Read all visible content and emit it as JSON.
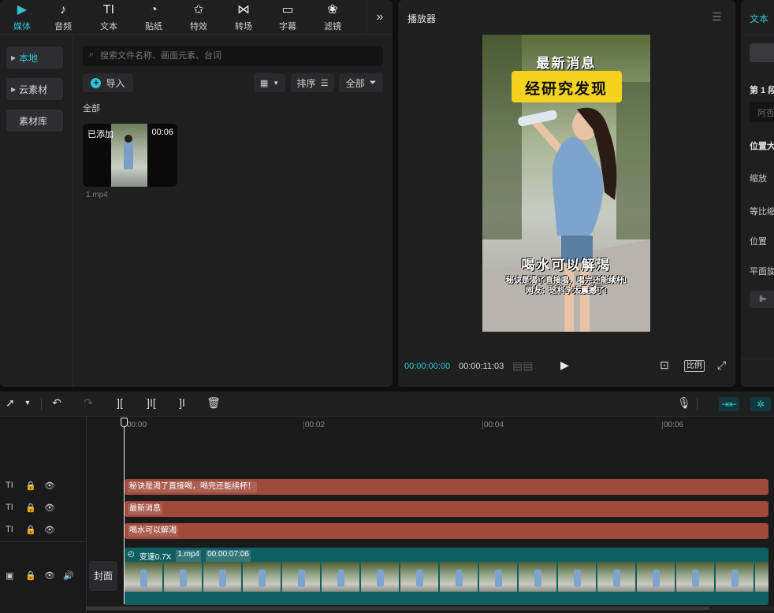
{
  "media_tabs": [
    {
      "icon": "media-icon",
      "glyph": "▶",
      "label": "媒体",
      "active": true
    },
    {
      "icon": "audio-icon",
      "glyph": "♪",
      "label": "音频",
      "active": false
    },
    {
      "icon": "text-icon",
      "glyph": "TI",
      "label": "文本",
      "active": false
    },
    {
      "icon": "sticker-icon",
      "glyph": "◔",
      "label": "贴纸",
      "active": false
    },
    {
      "icon": "effects-icon",
      "glyph": "✩",
      "label": "特效",
      "active": false
    },
    {
      "icon": "transition-icon",
      "glyph": "⋈",
      "label": "转场",
      "active": false
    },
    {
      "icon": "subtitle-icon",
      "glyph": "▭",
      "label": "字幕",
      "active": false
    },
    {
      "icon": "filter-icon",
      "glyph": "❀",
      "label": "滤镜",
      "active": false
    }
  ],
  "more_glyph": "»",
  "sidebar": {
    "local": "本地",
    "cloud": "云素材",
    "library": "素材库"
  },
  "search": {
    "placeholder": "搜索文件名称、画面元素、台词"
  },
  "toolbar": {
    "import_label": "导入",
    "sort_label": "排序",
    "all_label": "全部"
  },
  "section_label": "全部",
  "clip": {
    "added_badge": "已添加",
    "duration": "00:06",
    "filename": "1.mp4"
  },
  "player": {
    "title": "播放器",
    "current_time": "00:00:00:00",
    "total_time": "00:00:11:03",
    "ratio_label": "比例",
    "overlay_top": "最新消息",
    "overlay_banner": "经研究发现",
    "overlay_title": "喝水可以解渴",
    "overlay_sub1": "秘诀是渴了直接喝，喝完还能续杯!",
    "overlay_sub2": "网友：这科学太震撼了!"
  },
  "props": {
    "title": "文本",
    "section1": "第 1 段",
    "input_hint": "阿否",
    "pos_size": "位置大",
    "scale": "缩放",
    "uniform": "等比缩",
    "position": "位置",
    "rotation": "平面旋"
  },
  "timeline": {
    "ruler": [
      "00:00",
      "00:02",
      "00:04",
      "00:06"
    ],
    "text_tracks": [
      {
        "label": "秘诀是渴了直接喝，喝完还能续杯！"
      },
      {
        "label": "最新消息"
      },
      {
        "label": "喝水可以解渴"
      }
    ],
    "cover_label": "封面",
    "video_clip": {
      "speed": "变速0.7X",
      "name": "1.mp4",
      "duration": "00:00:07:06"
    }
  },
  "colors": {
    "accent": "#2bc4d6",
    "text_track": "#a04a3c",
    "video_track": "#0f5e63"
  }
}
